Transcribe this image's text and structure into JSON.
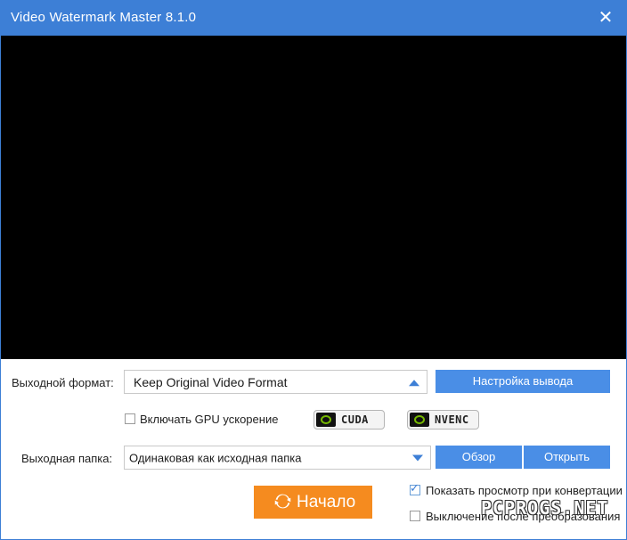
{
  "window": {
    "title": "Video Watermark Master 8.1.0",
    "close_icon": "close-icon"
  },
  "output_format": {
    "label": "Выходной формат:",
    "value": "Keep Original Video Format",
    "settings_button": "Настройка вывода"
  },
  "gpu": {
    "label": "Включать GPU ускорение",
    "checked": false,
    "cuda": "CUDA",
    "nvenc": "NVENC"
  },
  "output_folder": {
    "label": "Выходная папка:",
    "value": "Одинаковая как исходная папка",
    "browse_button": "Обзор",
    "open_button": "Открыть"
  },
  "start_button": "Начало",
  "options": {
    "show_preview": {
      "label": "Показать просмотр при конвертации",
      "checked": true
    },
    "shutdown": {
      "label": "Выключение после преобразования",
      "checked": false
    }
  },
  "watermark": "PCPROGS.NET",
  "colors": {
    "accent": "#3d7fd6",
    "button": "#4a8ee6",
    "start": "#f58b1f",
    "preview_bg": "#000000"
  }
}
